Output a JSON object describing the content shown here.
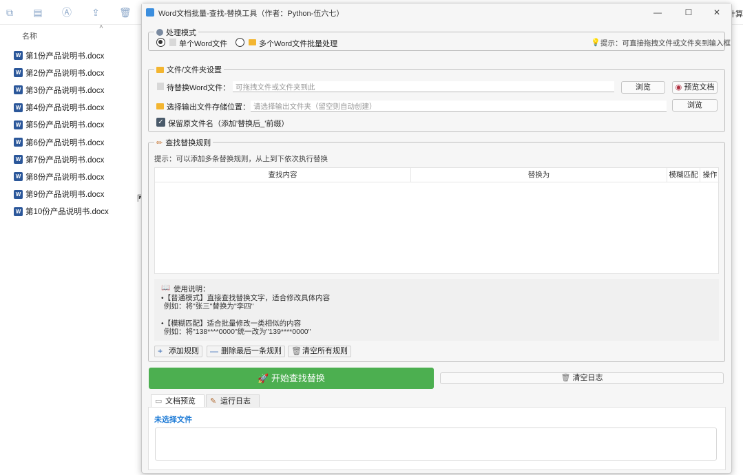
{
  "explorer": {
    "column_name": "名称",
    "right_text": "计算",
    "files": [
      "第1份产品说明书.docx",
      "第2份产品说明书.docx",
      "第3份产品说明书.docx",
      "第4份产品说明书.docx",
      "第5份产品说明书.docx",
      "第6份产品说明书.docx",
      "第7份产品说明书.docx",
      "第8份产品说明书.docx",
      "第9份产品说明书.docx",
      "第10份产品说明书.docx"
    ]
  },
  "window": {
    "title": "Word文档批量-查找-替换工具（作者：Python-伍六七）",
    "minimize": "—",
    "maximize": "☐",
    "close": "✕"
  },
  "mode": {
    "legend": "处理模式",
    "single_label": "单个Word文件",
    "batch_label": "多个Word文件批量处理",
    "hint": "提示：可直接拖拽文件或文件夹到输入框",
    "selected": "single"
  },
  "files": {
    "legend": "文件/文件夹设置",
    "source_label": "待替换Word文件：",
    "source_placeholder": "可拖拽文件或文件夹到此",
    "browse1": "浏览",
    "preview_doc": "预览文档",
    "output_label": "选择输出文件存储位置：",
    "output_placeholder": "请选择输出文件夹（留空则自动创建）",
    "browse2": "浏览",
    "keep_name_label": "保留原文件名（添加'替换后_'前缀）",
    "keep_name_checked": true
  },
  "rules": {
    "legend": "查找替换规则",
    "hint": "提示：可以添加多条替换规则，从上到下依次执行替换",
    "headers": [
      "查找内容",
      "替换为",
      "模糊匹配",
      "操作"
    ],
    "help": {
      "title": "使用说明：",
      "line1": "•【普通模式】直接查找替换文字，适合修改具体内容",
      "line2": "例如：将\"张三\"替换为\"李四\"",
      "line3": "•【模糊匹配】适合批量修改一类相似的内容",
      "line4": "例如：将\"138****0000\"统一改为\"139****0000\""
    },
    "add_rule": "添加规则",
    "delete_last": "删除最后一条规则",
    "clear_all": "清空所有规则"
  },
  "actions": {
    "start": "开始查找替换",
    "clear_log": "清空日志"
  },
  "tabs": {
    "preview": "文档预览",
    "log": "运行日志",
    "active": "preview"
  },
  "preview": {
    "title": "未选择文件"
  },
  "colors": {
    "start_button": "#4caf50",
    "preview_title": "#1e7bd6",
    "word_icon": "#2b579a",
    "folder": "#f3b530"
  }
}
